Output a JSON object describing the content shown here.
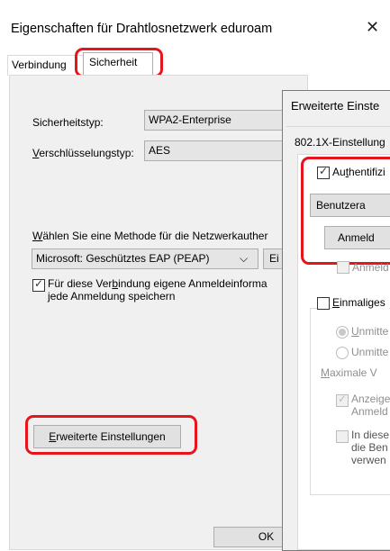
{
  "window": {
    "title": "Eigenschaften für Drahtlosnetzwerk eduroam",
    "close_glyph": "✕"
  },
  "tabs": [
    {
      "label": "Verbindung"
    },
    {
      "label": "Sicherheit"
    }
  ],
  "security": {
    "type_label": "Sicherheitstyp:",
    "type_value": "WPA2-Enterprise",
    "encryption_label": "Verschlüsselungstyp:",
    "encryption_value": "AES",
    "method_heading": "Wählen Sie eine Methode für die Netzwerkauther",
    "method_value": "Microsoft: Geschütztes EAP (PEAP)",
    "method_button_fragment": "Ei",
    "remember_line1": "Für diese Verbindung eigene Anmeldeinforma",
    "remember_line2": "jede Anmeldung speichern",
    "advanced_button": "Erweiterte Einstellungen",
    "ok_button": "OK"
  },
  "advanced_dialog": {
    "title": "Erweiterte Einste",
    "tab_label": "802.1X-Einstellung",
    "auth_checkbox": "Authentifizi",
    "user_button": "Benutzera",
    "login_button": "Anmeld",
    "disabled_checkbox": "Anmeld",
    "single_signon": "Einmaliges",
    "radio1": "Unmitte",
    "radio2": "Unmitte",
    "max_label": "Maximale V",
    "chk_show_line1": "Anzeige",
    "chk_show_line2": "Anmeld",
    "chk_in_line1": "In diese",
    "chk_in_line2": "die Ben",
    "chk_in_line3": "verwen"
  },
  "colors": {
    "highlight": "#e8141b",
    "dialog_bg": "#f0f0f0"
  }
}
